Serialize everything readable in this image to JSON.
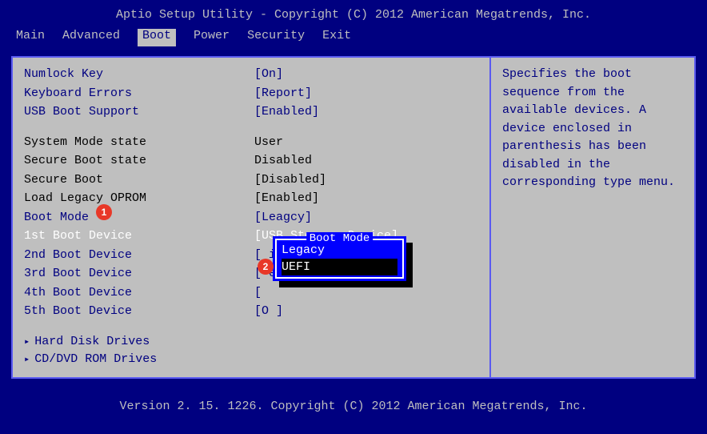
{
  "header": "Aptio Setup Utility - Copyright (C) 2012 American Megatrends, Inc.",
  "tabs": [
    "Main",
    "Advanced",
    "Boot",
    "Power",
    "Security",
    "Exit"
  ],
  "activeTab": "Boot",
  "settings_blue_top": [
    {
      "label": "Numlock Key",
      "value": "[On]"
    },
    {
      "label": "Keyboard Errors",
      "value": "[Report]"
    },
    {
      "label": "USB Boot Support",
      "value": "[Enabled]"
    }
  ],
  "settings_black": [
    {
      "label": "System Mode state",
      "value": "User"
    },
    {
      "label": "Secure Boot state",
      "value": "Disabled"
    },
    {
      "label": "Secure Boot",
      "value": "[Disabled]"
    },
    {
      "label": "Load Legacy OPROM",
      "value": "[Enabled]"
    }
  ],
  "boot_mode": {
    "label": "Boot Mode",
    "value": "[Leagcy]"
  },
  "boot_selected": {
    "label": "1st Boot Device",
    "value": "[USB Storage Device]"
  },
  "boot_rest": [
    {
      "label": "2nd Boot Device",
      "value": "[              ices: P...]"
    },
    {
      "label": "3rd Boot Device",
      "value": "[               es: W...]"
    },
    {
      "label": "4th Boot Device",
      "value": "[                        "
    },
    {
      "label": "5th Boot Device",
      "value": "[O                      ]"
    }
  ],
  "submenus": [
    "Hard Disk Drives",
    "CD/DVD ROM Drives"
  ],
  "popup": {
    "title": " Boot Mode ",
    "items": [
      "Legacy",
      "UEFI"
    ],
    "selected": "UEFI"
  },
  "help": "Specifies the boot sequence from the available devices. A device enclosed in parenthesis has been disabled in the corresponding type menu.",
  "footer": "Version 2. 15. 1226. Copyright (C) 2012 American Megatrends, Inc.",
  "markers": {
    "m1": "1",
    "m2": "2"
  }
}
